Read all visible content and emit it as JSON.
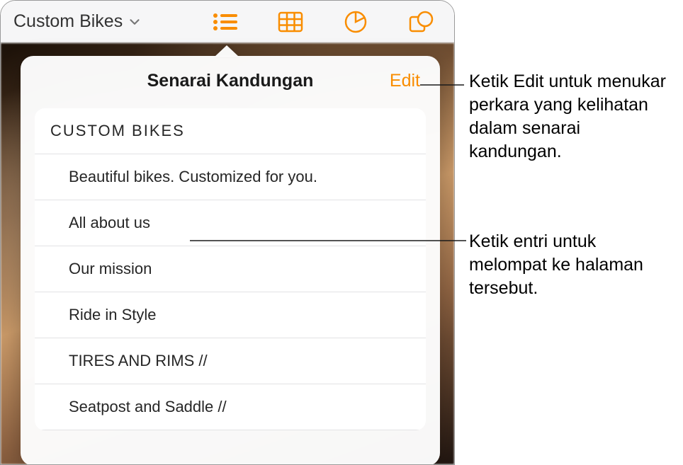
{
  "toolbar": {
    "doc_title": "Custom Bikes"
  },
  "popover": {
    "title": "Senarai Kandungan",
    "edit_label": "Edit",
    "items": [
      {
        "label": "CUSTOM  BIKES",
        "level": 0
      },
      {
        "label": "Beautiful bikes. Customized for you.",
        "level": 1
      },
      {
        "label": "All about us",
        "level": 1
      },
      {
        "label": "Our mission",
        "level": 1
      },
      {
        "label": "Ride in Style",
        "level": 1
      },
      {
        "label": "TIRES AND RIMS //",
        "level": 1
      },
      {
        "label": "Seatpost and Saddle //",
        "level": 1
      }
    ]
  },
  "callouts": [
    {
      "text": "Ketik Edit untuk menukar perkara yang kelihatan dalam senarai kandungan."
    },
    {
      "text": "Ketik entri untuk melompat ke halaman tersebut."
    }
  ]
}
